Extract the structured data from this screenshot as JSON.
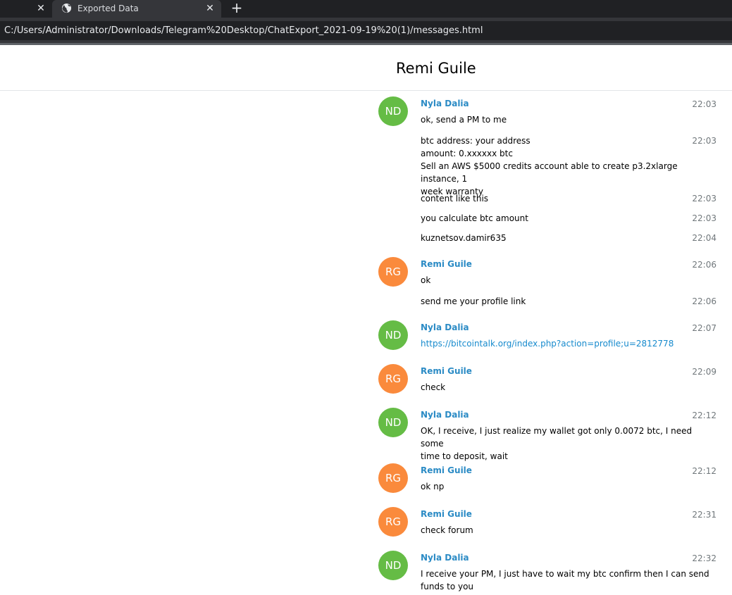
{
  "browser": {
    "tab_title": "Exported Data",
    "address": "C:/Users/Administrator/Downloads/Telegram%20Desktop/ChatExport_2021-09-19%20(1)/messages.html"
  },
  "chat": {
    "title": "Remi Guile"
  },
  "colors": {
    "nd_avatar": "#65bc45",
    "rg_avatar": "#fa8a3c",
    "sender_name": "#2b8bc5",
    "link": "#168acd"
  },
  "messages": [
    {
      "initials": "ND",
      "sender": "Nyla Dalia",
      "time": "22:03",
      "lines": [
        "ok, send a PM to me"
      ]
    },
    {
      "time": "22:03",
      "lines": [
        "btc address: your address",
        "amount: 0.xxxxxx btc",
        "Sell an AWS $5000 credits account able to create p3.2xlarge instance, 1",
        "week warranty"
      ]
    },
    {
      "time": "22:03",
      "lines": [
        "content like this"
      ]
    },
    {
      "time": "22:03",
      "lines": [
        "you calculate btc amount"
      ]
    },
    {
      "time": "22:04",
      "lines": [
        "kuznetsov.damir635"
      ]
    },
    {
      "initials": "RG",
      "sender": "Remi Guile",
      "time": "22:06",
      "lines": [
        "ok"
      ]
    },
    {
      "time": "22:06",
      "lines": [
        "send me your profile link"
      ]
    },
    {
      "initials": "ND",
      "sender": "Nyla Dalia",
      "time": "22:07",
      "lines": [
        "https://bitcointalk.org/index.php?action=profile;u=2812778"
      ]
    },
    {
      "initials": "RG",
      "sender": "Remi Guile",
      "time": "22:09",
      "lines": [
        "check"
      ]
    },
    {
      "initials": "ND",
      "sender": "Nyla Dalia",
      "time": "22:12",
      "lines": [
        "OK, I receive, I just realize my wallet got only 0.0072 btc, I need some",
        "time to deposit, wait"
      ]
    },
    {
      "initials": "RG",
      "sender": "Remi Guile",
      "time": "22:12",
      "lines": [
        "ok np"
      ]
    },
    {
      "initials": "RG",
      "sender": "Remi Guile",
      "time": "22:31",
      "lines": [
        "check forum"
      ]
    },
    {
      "initials": "ND",
      "sender": "Nyla Dalia",
      "time": "22:32",
      "lines": [
        "I receive your PM, I just have to wait my btc confirm then I can send",
        "funds to you"
      ]
    }
  ]
}
